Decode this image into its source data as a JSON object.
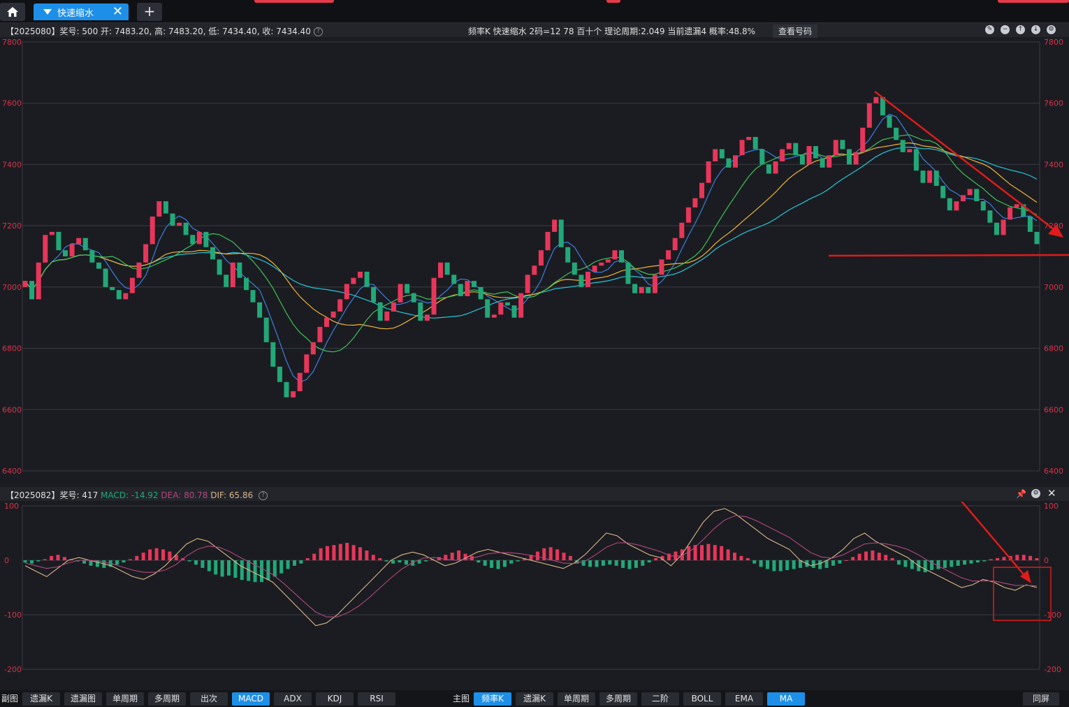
{
  "tabs": {
    "home_icon": "home-icon",
    "active_label": "快速缩水",
    "close_glyph": "✕",
    "new_tab_glyph": "+"
  },
  "main_header": {
    "stats": "【2025080】奖号: 500  开: 7483.20, 高: 7483.20, 低: 7434.40, 收: 7434.40",
    "center": "频率K  快速缩水  2码=12 78  百十个  理论周期:2.049  当前遗漏4  概率:48.8%",
    "view_button": "查看号码"
  },
  "sub_header": {
    "prefix": "【2025082】奖号: 417",
    "macd": "MACD: -14.92",
    "dea": "DEA: 80.78",
    "dif": "DIF: 65.86"
  },
  "colors": {
    "up": "#e8365a",
    "down": "#22a878",
    "ma5": "#3b7fe0",
    "ma10": "#26c6d8",
    "ma20": "#f0b43a",
    "ma30": "#3fc25a",
    "dif": "#d9b78a",
    "dea": "#b0487e",
    "annotation": "#e01b1b",
    "accent": "#1e8fe8"
  },
  "chart_data": [
    {
      "type": "candlestick",
      "axis_ticks": [
        "7800",
        "7600",
        "7400",
        "7200",
        "7000",
        "6800",
        "6600",
        "6400"
      ],
      "ylim": [
        6400,
        7800
      ],
      "grid": true,
      "series": [
        {
          "name": "close",
          "values": [
            7020,
            6960,
            7080,
            7170,
            7180,
            7120,
            7100,
            7140,
            7160,
            7120,
            7080,
            7060,
            7000,
            6990,
            6960,
            6980,
            7030,
            7080,
            7140,
            7230,
            7280,
            7240,
            7200,
            7210,
            7170,
            7140,
            7180,
            7130,
            7090,
            7040,
            7000,
            7080,
            7030,
            6990,
            6950,
            6900,
            6820,
            6740,
            6690,
            6640,
            6660,
            6720,
            6780,
            6820,
            6870,
            6900,
            6920,
            6960,
            7010,
            7030,
            7050,
            7000,
            6950,
            6890,
            6920,
            6950,
            7010,
            6980,
            6950,
            6890,
            6910,
            7030,
            7080,
            7040,
            7010,
            6970,
            7020,
            7000,
            6960,
            6900,
            6910,
            6950,
            6940,
            6900,
            6980,
            7040,
            7070,
            7120,
            7180,
            7220,
            7130,
            7080,
            7040,
            7000,
            7050,
            7070,
            7080,
            7090,
            7120,
            7080,
            7010,
            6980,
            7000,
            6980,
            7040,
            7090,
            7120,
            7160,
            7210,
            7260,
            7290,
            7340,
            7410,
            7450,
            7420,
            7390,
            7430,
            7480,
            7490,
            7450,
            7400,
            7370,
            7410,
            7450,
            7470,
            7430,
            7400,
            7460,
            7420,
            7390,
            7430,
            7480,
            7450,
            7400,
            7440,
            7520,
            7600,
            7620,
            7560,
            7520,
            7480,
            7440,
            7450,
            7380,
            7340,
            7380,
            7330,
            7290,
            7250,
            7280,
            7300,
            7320,
            7280,
            7250,
            7210,
            7170,
            7220,
            7260,
            7270,
            7230,
            7180,
            7140
          ]
        }
      ]
    },
    {
      "type": "bar",
      "axis_ticks": [
        "100",
        "0",
        "-100",
        "-200"
      ],
      "ylim": [
        -200,
        100
      ],
      "grid": true,
      "series": [
        {
          "name": "MACD",
          "values": [
            -4,
            -6,
            -2,
            2,
            8,
            10,
            6,
            2,
            -2,
            -6,
            -10,
            -12,
            -14,
            -12,
            -8,
            -4,
            2,
            8,
            14,
            20,
            22,
            20,
            16,
            10,
            4,
            -2,
            -8,
            -14,
            -20,
            -26,
            -30,
            -28,
            -32,
            -36,
            -38,
            -40,
            -40,
            -36,
            -30,
            -24,
            -16,
            -10,
            -6,
            4,
            12,
            22,
            26,
            28,
            30,
            32,
            28,
            24,
            18,
            10,
            4,
            -2,
            -6,
            -4,
            -8,
            -10,
            -6,
            -2,
            2,
            6,
            10,
            14,
            18,
            12,
            8,
            -4,
            -10,
            -14,
            -16,
            -12,
            -6,
            -2,
            4,
            10,
            16,
            22,
            24,
            20,
            14,
            8,
            -6,
            -10,
            -12,
            -12,
            -10,
            -8,
            -10,
            -14,
            -16,
            -14,
            -10,
            -4,
            4,
            8,
            12,
            16,
            20,
            26,
            28,
            28,
            30,
            28,
            26,
            20,
            14,
            8,
            4,
            -6,
            -12,
            -16,
            -20,
            -20,
            -18,
            -16,
            -14,
            -12,
            -14,
            -16,
            -14,
            -10,
            -6,
            0,
            6,
            12,
            16,
            18,
            14,
            10,
            4,
            -8,
            -12,
            -16,
            -20,
            -22,
            -18,
            -16,
            -14,
            -12,
            -10,
            -8,
            -6,
            -4,
            -2,
            2,
            4,
            6,
            8,
            10,
            10,
            8,
            4
          ]
        },
        {
          "name": "DIF",
          "values": [
            -10,
            -20,
            -30,
            -15,
            0,
            5,
            0,
            -5,
            -10,
            -20,
            -30,
            -35,
            -25,
            -10,
            10,
            30,
            40,
            35,
            20,
            5,
            -10,
            -20,
            -30,
            -40,
            -60,
            -80,
            -100,
            -120,
            -115,
            -100,
            -80,
            -60,
            -40,
            -20,
            0,
            10,
            15,
            10,
            0,
            -10,
            -5,
            5,
            15,
            20,
            15,
            10,
            5,
            0,
            -5,
            -10,
            -15,
            -5,
            10,
            30,
            50,
            45,
            30,
            20,
            10,
            5,
            -10,
            10,
            40,
            70,
            90,
            95,
            85,
            70,
            55,
            40,
            30,
            20,
            0,
            -10,
            -5,
            5,
            20,
            40,
            50,
            35,
            25,
            15,
            5,
            -10,
            -20,
            -30,
            -40,
            -50,
            -45,
            -35,
            -40,
            -50,
            -55,
            -45,
            -50
          ]
        },
        {
          "name": "DEA",
          "values": [
            -5,
            -10,
            -15,
            -12,
            -5,
            0,
            0,
            -2,
            -6,
            -12,
            -18,
            -22,
            -22,
            -18,
            -8,
            8,
            20,
            26,
            24,
            16,
            5,
            -5,
            -15,
            -26,
            -42,
            -60,
            -78,
            -95,
            -104,
            -104,
            -96,
            -84,
            -68,
            -50,
            -32,
            -16,
            -4,
            4,
            5,
            2,
            0,
            2,
            6,
            12,
            14,
            14,
            12,
            9,
            5,
            0,
            -5,
            -6,
            -2,
            10,
            24,
            32,
            32,
            28,
            22,
            16,
            8,
            8,
            20,
            38,
            58,
            74,
            82,
            80,
            72,
            62,
            52,
            42,
            28,
            14,
            6,
            4,
            10,
            20,
            30,
            32,
            30,
            26,
            20,
            10,
            -2,
            -12,
            -22,
            -32,
            -38,
            -38,
            -38,
            -42,
            -46,
            -46,
            -47
          ]
        }
      ]
    }
  ],
  "bottom_toolbar": {
    "sub_label": "副图",
    "sub_buttons": [
      "遗漏K",
      "遗漏图",
      "单周期",
      "多周期",
      "出次",
      "MACD",
      "ADX",
      "KDJ",
      "RSI"
    ],
    "sub_active": "MACD",
    "main_label": "主图",
    "main_buttons": [
      "频率K",
      "遗漏K",
      "单周期",
      "多周期",
      "二阶",
      "BOLL",
      "EMA",
      "MA"
    ],
    "main_active": [
      "频率K",
      "MA"
    ],
    "right_button": "同屏"
  }
}
